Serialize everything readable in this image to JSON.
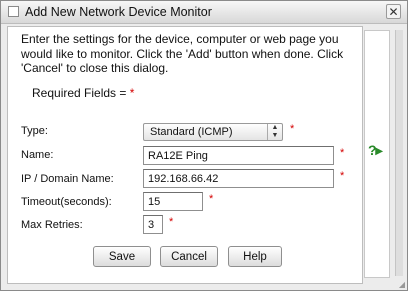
{
  "window": {
    "title": "Add New Network Device Monitor",
    "close_glyph": "✕"
  },
  "intro_text": "Enter the settings for the device, computer or web page you would like to monitor. Click the 'Add' button when done. Click 'Cancel' to close this dialog.",
  "required_label": "Required Fields = ",
  "required_marker": "*",
  "fields": {
    "type": {
      "label": "Type:",
      "value": "Standard (ICMP)"
    },
    "name": {
      "label": "Name:",
      "value": "RA12E Ping"
    },
    "ip": {
      "label": "IP / Domain Name:",
      "value": "192.168.66.42"
    },
    "timeout": {
      "label": "Timeout(seconds):",
      "value": "15"
    },
    "retries": {
      "label": "Max Retries:",
      "value": "3"
    }
  },
  "buttons": {
    "save": "Save",
    "cancel": "Cancel",
    "help": "Help"
  },
  "help_toggle": "?▸",
  "colors": {
    "required": "#d40000",
    "help_icon": "#2a8a2a"
  }
}
